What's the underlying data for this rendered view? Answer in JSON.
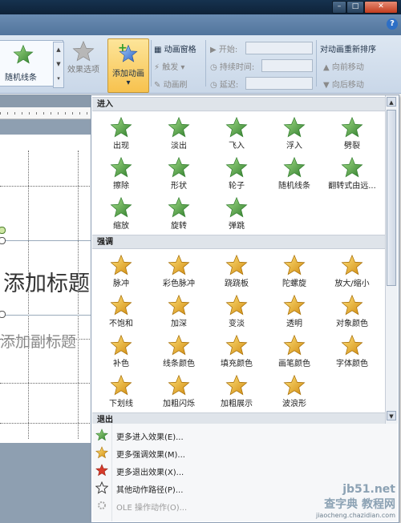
{
  "window": {
    "controls": {
      "minimize": "–",
      "maximize": "□",
      "close": "✕"
    },
    "help_label": "?"
  },
  "ribbon": {
    "gallery_label": "随机线条",
    "effect_options_label": "效果选项",
    "add_animation_label": "添加动画",
    "animation_pane_label": "动画窗格",
    "trigger_label": "触发",
    "animation_painter_label": "动画刷",
    "start_label": "开始:",
    "duration_label": "持续时间:",
    "delay_label": "延迟:",
    "reorder_title": "对动画重新排序",
    "move_earlier_label": "向前移动",
    "move_later_label": "向后移动"
  },
  "slide": {
    "title_placeholder": "添加标题",
    "subtitle_placeholder": "添加副标题"
  },
  "panel": {
    "sections": {
      "entrance": "进入",
      "emphasis": "强调",
      "exit": "退出"
    },
    "entrance_effects": [
      "出现",
      "淡出",
      "飞入",
      "浮入",
      "劈裂",
      "擦除",
      "形状",
      "轮子",
      "随机线条",
      "翻转式由远...",
      "缩放",
      "旋转",
      "弹跳"
    ],
    "emphasis_effects": [
      "脉冲",
      "彩色脉冲",
      "跷跷板",
      "陀螺旋",
      "放大/缩小",
      "不饱和",
      "加深",
      "变淡",
      "透明",
      "对象颜色",
      "补色",
      "线条颜色",
      "填充颜色",
      "画笔颜色",
      "字体颜色",
      "下划线",
      "加粗闪烁",
      "加粗展示",
      "波浪形"
    ],
    "menu": [
      {
        "label": "更多进入效果(E)...",
        "icon": "green-star-icon"
      },
      {
        "label": "更多强调效果(M)...",
        "icon": "yellow-star-icon"
      },
      {
        "label": "更多退出效果(X)...",
        "icon": "red-star-icon"
      },
      {
        "label": "其他动作路径(P)...",
        "icon": "outline-star-icon"
      },
      {
        "label": "OLE 操作动作(O)...",
        "icon": "gear-icon"
      }
    ]
  },
  "watermark": {
    "line1": "jb51.net",
    "line2": "查字典 教程网",
    "line3": "jiaocheng.chazidian.com"
  },
  "colors": {
    "entrance": "#3e9a3a",
    "emphasis": "#f0b428",
    "exit": "#d63a2a",
    "accent": "#f7c24e"
  }
}
